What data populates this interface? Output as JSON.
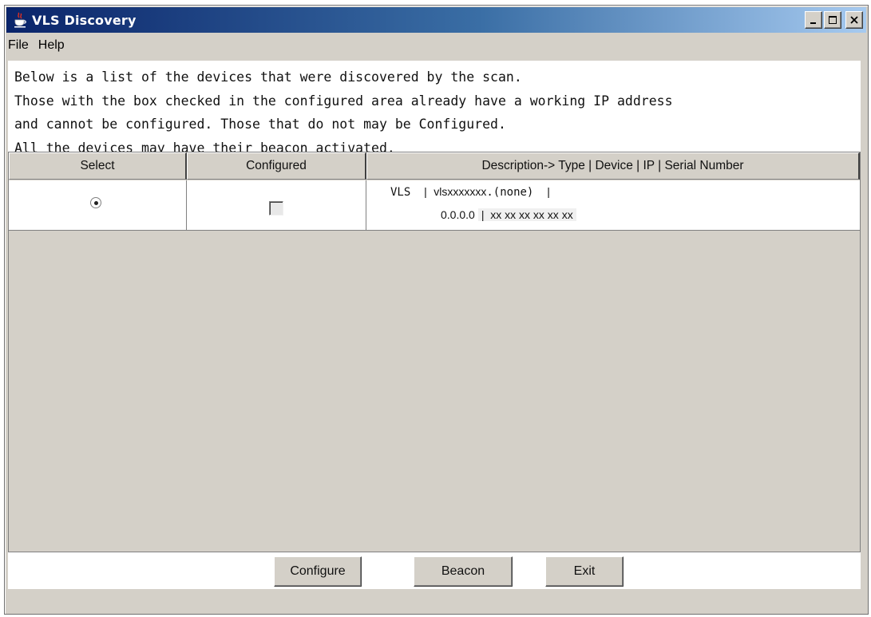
{
  "window": {
    "title": "VLS Discovery",
    "app_icon": "java-cup-icon",
    "controls": [
      "minimize-icon",
      "maximize-icon",
      "close-icon"
    ]
  },
  "menu": {
    "items": [
      {
        "label": "File"
      },
      {
        "label": "Help"
      }
    ]
  },
  "info": {
    "lines": [
      "Below is a list of the devices that were discovered by the scan.",
      "Those with the box checked in the configured area already have a working IP address",
      "and cannot be configured. Those that do not may be Configured.",
      "All the devices may have their beacon activated."
    ]
  },
  "table": {
    "columns": [
      "Select",
      "Configured",
      "Description-> Type | Device | IP | Serial Number"
    ],
    "rows": [
      {
        "selected": true,
        "configured": false,
        "type": "VLS",
        "device": "vlsxxxxxxx",
        "domain": ".(none)",
        "ip": "0.0.0.0",
        "serial": "xx xx xx xx xx xx",
        "separator": "|"
      }
    ]
  },
  "buttons": {
    "configure": "Configure",
    "beacon": "Beacon",
    "exit": "Exit"
  },
  "colors": {
    "window_bg": "#d4d0c8",
    "title_gradient_start": "#0a246a",
    "title_gradient_end": "#a6caf0"
  }
}
